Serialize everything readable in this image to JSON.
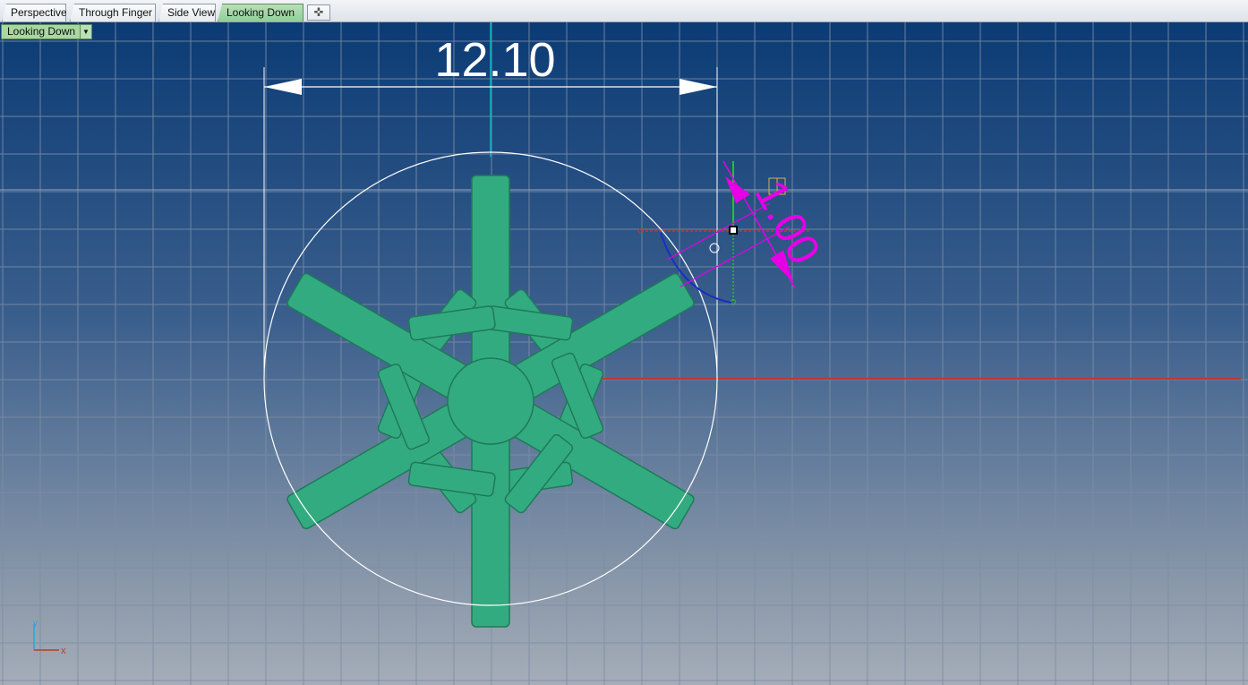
{
  "tabs": [
    {
      "label": "Perspective",
      "active": false
    },
    {
      "label": "Through Finger",
      "active": false
    },
    {
      "label": "Side View",
      "active": false
    },
    {
      "label": "Looking Down",
      "active": true
    }
  ],
  "add_tab_symbol": "✜",
  "viewport": {
    "view_name": "Looking Down",
    "dimension_diameter": "12.10",
    "dimension_thickness": "1.00",
    "axis_x_label": "x",
    "axis_y_label": "y"
  },
  "colors": {
    "snowflake_fill": "#33ab80",
    "snowflake_stroke": "#1f7a59",
    "dimension_white": "#ffffff",
    "dimension_magenta": "#e600e6",
    "x_axis": "#c0392b",
    "y_axis": "#27c12a",
    "grid": "#7d8ea5"
  }
}
